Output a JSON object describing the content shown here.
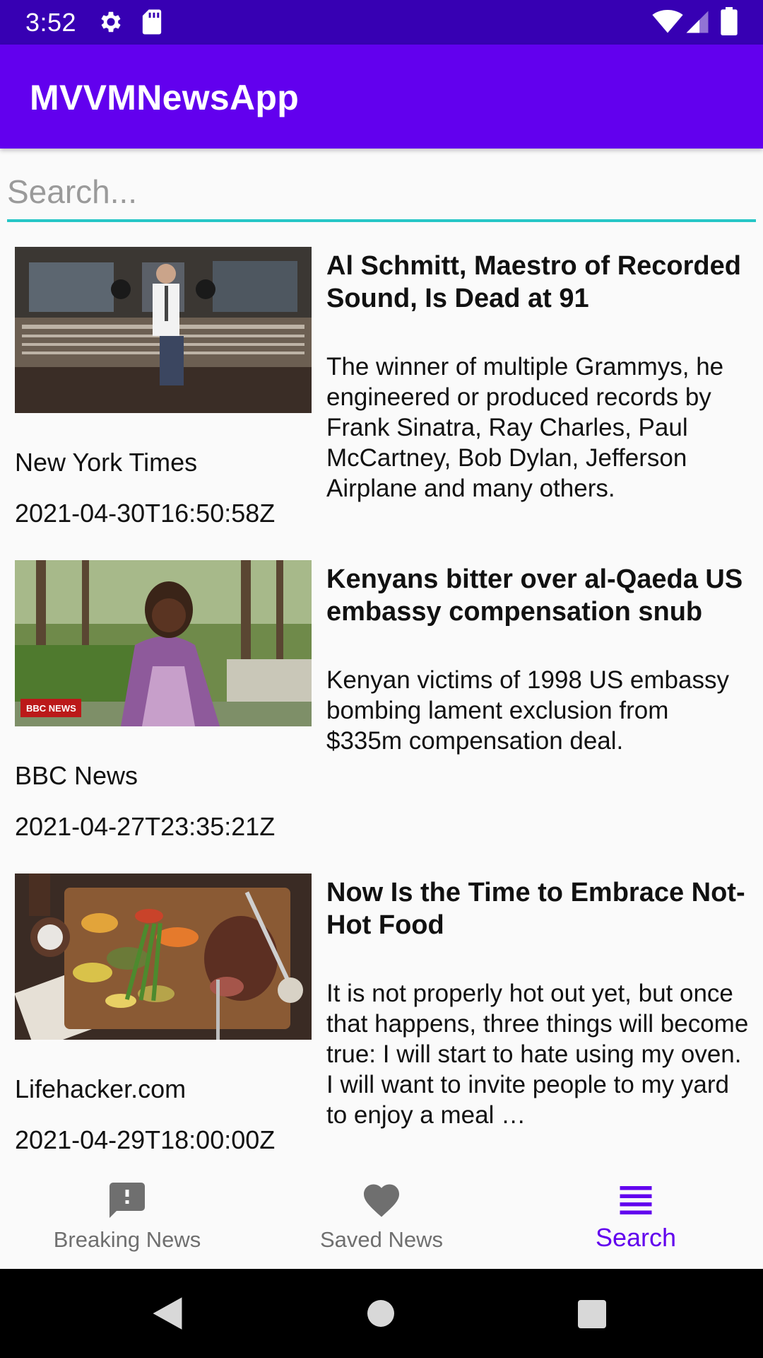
{
  "status_bar": {
    "time": "3:52",
    "icons": [
      "gear-icon",
      "sd-card-icon",
      "wifi-icon",
      "signal-icon",
      "battery-icon"
    ]
  },
  "app_bar": {
    "title": "MVVMNewsApp",
    "color": "#6200ee"
  },
  "search": {
    "placeholder": "Search...",
    "value": "",
    "underline_color": "#26c6c6"
  },
  "articles": [
    {
      "title": "Al Schmitt, Maestro of Recorded Sound, Is Dead at 91",
      "description": "The winner of multiple Grammys, he engineered or produced records by Frank Sinatra, Ray Charles, Paul McCartney, Bob Dylan, Jefferson Airplane and many others.",
      "source": "New York Times",
      "published_at": "2021-04-30T16:50:58Z"
    },
    {
      "title": "Kenyans bitter over al-Qaeda US embassy compensation snub",
      "description": "Kenyan victims of 1998 US embassy bombing lament exclusion from $335m compensation deal.",
      "source": "BBC News",
      "published_at": "2021-04-27T23:35:21Z",
      "image_watermark": "BBC NEWS"
    },
    {
      "title": "Now Is the Time to Embrace Not-Hot Food",
      "description": "It is not properly hot out yet, but once that happens, three things will become true: I will start to hate using my oven. I will want to invite people to my yard to enjoy a meal …",
      "source": "Lifehacker.com",
      "published_at": "2021-04-29T18:00:00Z"
    }
  ],
  "bottom_nav": {
    "items": [
      {
        "label": "Breaking News",
        "icon": "alert-message-icon",
        "active": false
      },
      {
        "label": "Saved News",
        "icon": "heart-icon",
        "active": false
      },
      {
        "label": "Search",
        "icon": "list-lines-icon",
        "active": true
      }
    ],
    "active_color": "#6200ee",
    "inactive_color": "#6f6f6f"
  },
  "system_nav": {
    "buttons": [
      "back-icon",
      "home-icon",
      "recents-icon"
    ]
  }
}
